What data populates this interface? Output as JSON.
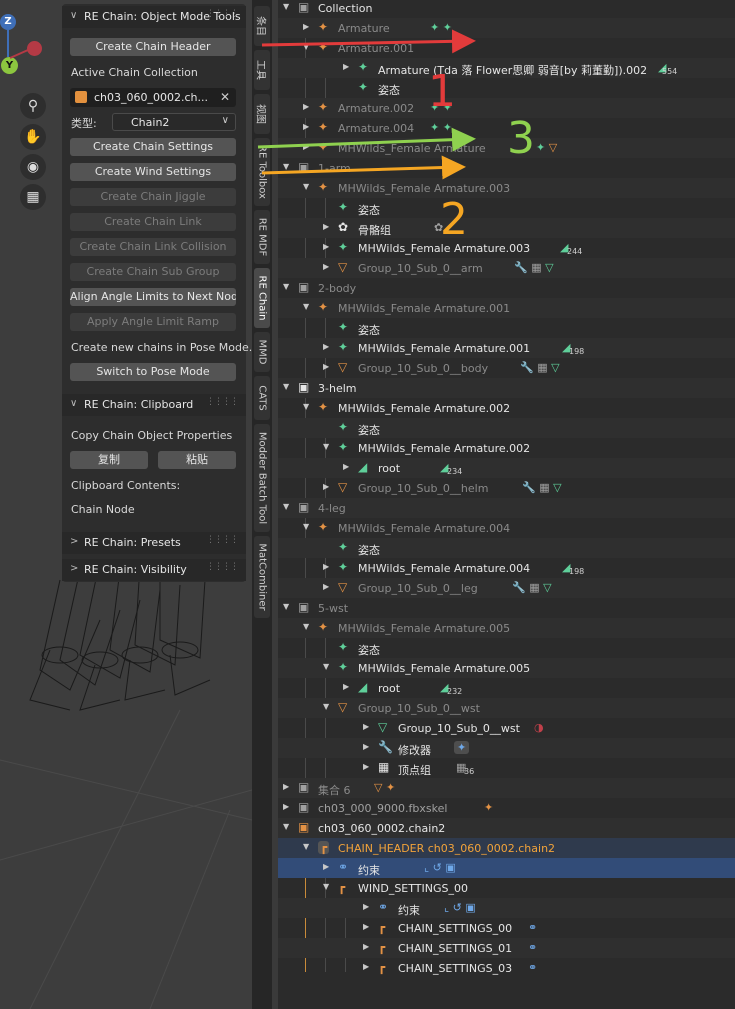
{
  "viewport": {
    "gizmo_z": "Z",
    "gizmo_y": "Y",
    "tool_icons": [
      "zoom-icon",
      "hand-icon",
      "camera-icon",
      "grid-icon"
    ]
  },
  "npanel": {
    "object_tools": {
      "title": "RE Chain: Object Mode Tools",
      "create_chain_header": "Create Chain Header",
      "active_collection_label": "Active Chain Collection",
      "collection_value": "ch03_060_0002.ch...",
      "type_label": "类型:",
      "type_value": "Chain2",
      "create_chain_settings": "Create Chain Settings",
      "create_wind_settings": "Create Wind Settings",
      "create_chain_jiggle": "Create Chain Jiggle",
      "create_chain_link": "Create Chain Link",
      "create_chain_link_collision": "Create Chain Link Collision",
      "create_chain_sub_group": "Create Chain Sub Group",
      "align_angle_limits": "Align Angle Limits to Next Node",
      "apply_angle_limit_ramp": "Apply Angle Limit Ramp",
      "pose_mode_hint": "Create new chains in Pose Mode.",
      "switch_to_pose_mode": "Switch to Pose Mode"
    },
    "clipboard": {
      "title": "RE Chain: Clipboard",
      "copy_props_label": "Copy Chain Object Properties",
      "copy_button": "复制",
      "paste_button": "粘贴",
      "contents_label": "Clipboard Contents:",
      "contents_value": "Chain Node"
    },
    "presets": {
      "title": "RE Chain: Presets"
    },
    "visibility": {
      "title": "RE Chain: Visibility"
    }
  },
  "tabs": [
    "条目",
    "工具",
    "视图",
    "RE Toolbox",
    "RE MDF",
    "RE Chain",
    "MMD",
    "CATS",
    "Modder Batch Tool",
    "MatCombiner"
  ],
  "outliner": {
    "r0": "Collection",
    "r1": "Armature",
    "r2": "Armature.001",
    "r3": "Armature (Tda 落 Flower思卿 弱音[by 莉董勤]).002",
    "r3_count": "554",
    "r4": "姿态",
    "r5": "Armature.002",
    "r6": "Armature.004",
    "r7": "MHWilds_Female Armature",
    "r8": "1-arm",
    "r9": "MHWilds_Female Armature.003",
    "r10": "姿态",
    "r11": "骨骼组",
    "r12": "MHWilds_Female Armature.003",
    "r12_count": "244",
    "r13": "Group_10_Sub_0__arm",
    "r14": "2-body",
    "r15": "MHWilds_Female Armature.001",
    "r16": "姿态",
    "r17": "MHWilds_Female Armature.001",
    "r17_count": "198",
    "r18": "Group_10_Sub_0__body",
    "r19": "3-helm",
    "r20": "MHWilds_Female Armature.002",
    "r21": "姿态",
    "r22": "MHWilds_Female Armature.002",
    "r23": "root",
    "r23_count": "234",
    "r24": "Group_10_Sub_0__helm",
    "r25": "4-leg",
    "r26": "MHWilds_Female Armature.004",
    "r27": "姿态",
    "r28": "MHWilds_Female Armature.004",
    "r28_count": "198",
    "r29": "Group_10_Sub_0__leg",
    "r30": "5-wst",
    "r31": "MHWilds_Female Armature.005",
    "r32": "姿态",
    "r33": "MHWilds_Female Armature.005",
    "r34": "root",
    "r34_count": "232",
    "r35": "Group_10_Sub_0__wst",
    "r36": "Group_10_Sub_0__wst",
    "r37": "修改器",
    "r38": "顶点组",
    "r38_count": "36",
    "r39": "集合 6",
    "r40": "ch03_000_9000.fbxskel",
    "r41": "ch03_060_0002.chain2",
    "r42": "CHAIN_HEADER ch03_060_0002.chain2",
    "r43": "约束",
    "r44": "WIND_SETTINGS_00",
    "r45": "约束",
    "r46": "CHAIN_SETTINGS_00",
    "r47": "CHAIN_SETTINGS_01",
    "r48": "CHAIN_SETTINGS_03"
  },
  "annotations": {
    "n1": "1",
    "n2": "2",
    "n3": "3",
    "colors": {
      "red": "#e23b3b",
      "green": "#8fd14f",
      "orange": "#f5a623"
    }
  }
}
